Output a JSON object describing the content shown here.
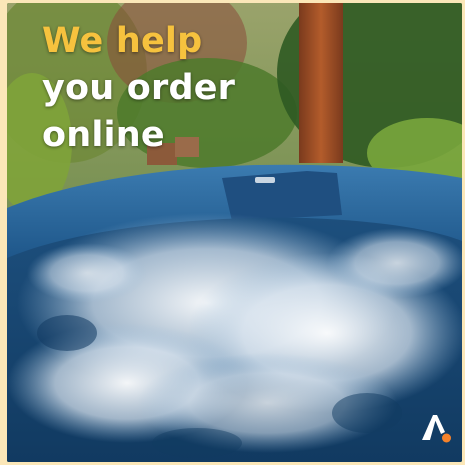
{
  "headline": {
    "line_1": "We help",
    "line_2": "you order",
    "line_3": "online"
  },
  "colors": {
    "headline_accent": "#f6c23e",
    "headline_text": "#ffffff",
    "frame_background": "#fbe7b8",
    "logo_white": "#ffffff",
    "logo_orange": "#f5822a",
    "water_blue": "#16436f"
  },
  "icons": {
    "brand_logo": "brand-logo-icon"
  }
}
